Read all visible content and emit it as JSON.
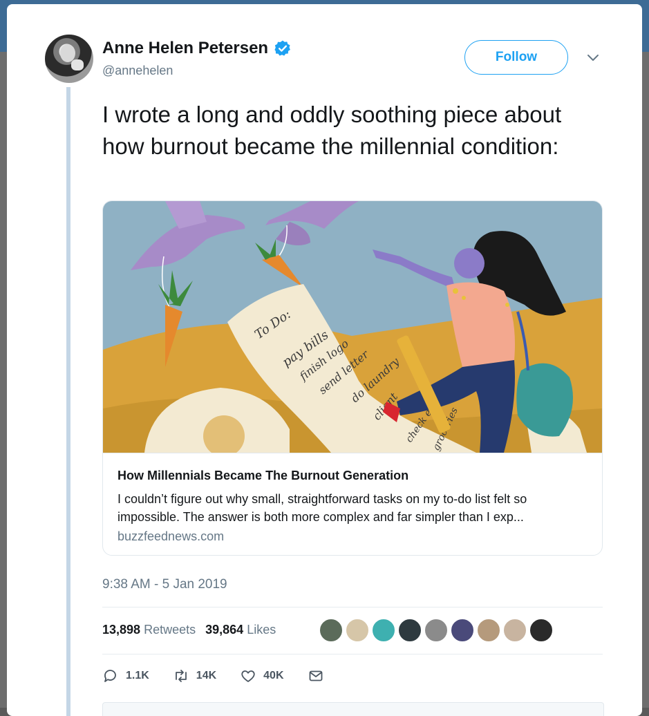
{
  "tweet": {
    "author_name": "Anne Helen Petersen",
    "handle": "@annehelen",
    "follow_label": "Follow",
    "text": "I wrote a long and oddly soothing piece about how burnout became the millennial condition:",
    "timestamp": "9:38 AM - 5 Jan 2019"
  },
  "link_card": {
    "title": "How Millennials Became The Burnout Generation",
    "description": "I couldn’t figure out why small, straightforward tasks on my to-do list felt so impossible. The answer is both more complex and far simpler than I exp...",
    "domain": "buzzfeednews.com",
    "image_text": {
      "todo_heading": "To Do:",
      "items": [
        "pay bills",
        "finish logo",
        "send letter",
        "do laundry",
        "client",
        "check email",
        "groceries"
      ]
    }
  },
  "stats": {
    "retweets_count": "13,898",
    "retweets_label": "Retweets",
    "likes_count": "39,864",
    "likes_label": "Likes",
    "liker_colors": [
      "#5b6b5a",
      "#d6c6a8",
      "#3eb0b0",
      "#2e3a3f",
      "#8b8b8b",
      "#4a4a7a",
      "#b59a7c",
      "#c8b4a0",
      "#2a2a2a"
    ]
  },
  "actions": {
    "reply_count": "1.1K",
    "retweet_count": "14K",
    "like_count": "40K"
  },
  "colors": {
    "accent": "#1da1f2",
    "text": "#14171a",
    "secondary": "#657786"
  }
}
